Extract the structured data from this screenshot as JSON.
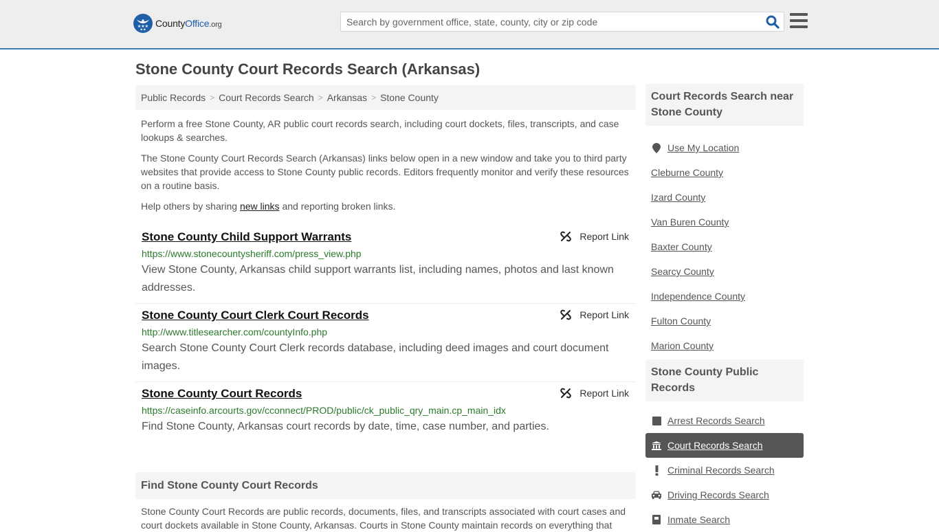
{
  "header": {
    "logo": {
      "county": "County",
      "office": "Office",
      "org": ".org",
      "icon": "eagle-stars-badge-icon"
    },
    "search": {
      "placeholder": "Search by government office, state, county, city or zip code",
      "value": "",
      "icon": "search-icon"
    },
    "menu_icon": "hamburger-menu-icon",
    "accent_color": "#3b7eb0"
  },
  "page": {
    "title": "Stone County Court Records Search (Arkansas)"
  },
  "breadcrumb": [
    {
      "label": "Public Records"
    },
    {
      "label": "Court Records Search"
    },
    {
      "label": "Arkansas"
    },
    {
      "label": "Stone County"
    }
  ],
  "intro": {
    "p1": "Perform a free Stone County, AR public court records search, including court dockets, files, transcripts, and case lookups & searches.",
    "p2": "The Stone County Court Records Search (Arkansas) links below open in a new window and take you to third party websites that provide access to Stone County public records. Editors frequently monitor and verify these resources on a routine basis.",
    "p3_before": "Help others by sharing ",
    "p3_link": "new links",
    "p3_after": " and reporting broken links."
  },
  "results": [
    {
      "title": "Stone County Child Support Warrants",
      "url": "https://www.stonecountysheriff.com/press_view.php",
      "description": "View Stone County, Arkansas child support warrants list, including names, photos and last known addresses.",
      "report_label": "Report Link"
    },
    {
      "title": "Stone County Court Clerk Court Records",
      "url": "http://www.titlesearcher.com/countyInfo.php",
      "description": "Search Stone County Court Clerk records database, including deed images and court document images.",
      "report_label": "Report Link"
    },
    {
      "title": "Stone County Court Records",
      "url": "https://caseinfo.arcourts.gov/cconnect/PROD/public/ck_public_qry_main.cp_main_idx",
      "description": "Find Stone County, Arkansas court records by date, time, case number, and parties.",
      "report_label": "Report Link"
    }
  ],
  "find_section": {
    "heading": "Find Stone County Court Records",
    "body": "Stone County Court Records are public records, documents, files, and transcripts associated with court cases and court dockets available in Stone County, Arkansas. Courts in Stone County maintain records on everything that"
  },
  "sidebar": {
    "nearby": {
      "heading": "Court Records Search near Stone County",
      "use_location": "Use My Location",
      "counties": [
        "Cleburne County",
        "Izard County",
        "Van Buren County",
        "Baxter County",
        "Searcy County",
        "Independence County",
        "Fulton County",
        "Marion County"
      ]
    },
    "public_records": {
      "heading": "Stone County Public Records",
      "items": [
        {
          "label": "Arrest Records Search",
          "icon": "square-icon",
          "active": false
        },
        {
          "label": "Court Records Search",
          "icon": "courthouse-icon",
          "active": true
        },
        {
          "label": "Criminal Records Search",
          "icon": "exclamation-icon",
          "active": false
        },
        {
          "label": "Driving Records Search",
          "icon": "car-icon",
          "active": false
        },
        {
          "label": "Inmate Search",
          "icon": "jail-icon",
          "active": false
        }
      ]
    }
  }
}
